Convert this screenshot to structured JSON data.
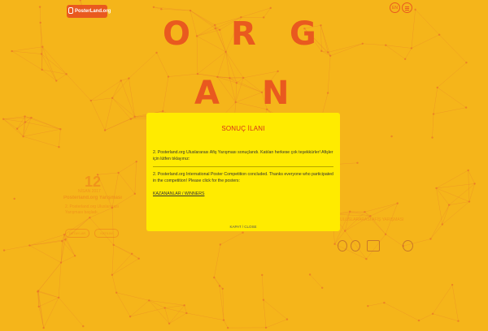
{
  "header": {
    "logo_text": "PosterLand.org",
    "lang_label": "EN"
  },
  "hero": {
    "letters_row1": [
      "O",
      "R",
      "G"
    ],
    "letters_row2": [
      "A",
      "N"
    ]
  },
  "background": {
    "date_day": "12",
    "date_month": "NİSAN 2017",
    "side_title": "Posterland.org Yarışması",
    "side_item": "2. Posterland.org Uluslararası Yarışması başladı.",
    "side_buttons": [
      "DETAYLAR",
      "KATILIM"
    ],
    "right_text": "ULUSLARARASI AFİŞ YARIŞMASI"
  },
  "modal": {
    "title": "SONUÇ İLANI",
    "tr_text": "2. Posterland.org Uluslararası Afiş Yarışması sonuçlandı. Katılan herkese çok teşekkürler! Afişler için lütfen tıklayınız:",
    "en_text": "2. Posterland.org International Poster Competition concluded. Thanks everyone who participated in the competition! Please click for the posters:",
    "link_label": "KAZANANLAR / WINNERS",
    "close_label": "KAPAT / CLOSE"
  },
  "colors": {
    "background": "#f5b51a",
    "accent": "#e9591f",
    "modal_bg": "#ffeb00",
    "modal_title": "#d6311b"
  }
}
